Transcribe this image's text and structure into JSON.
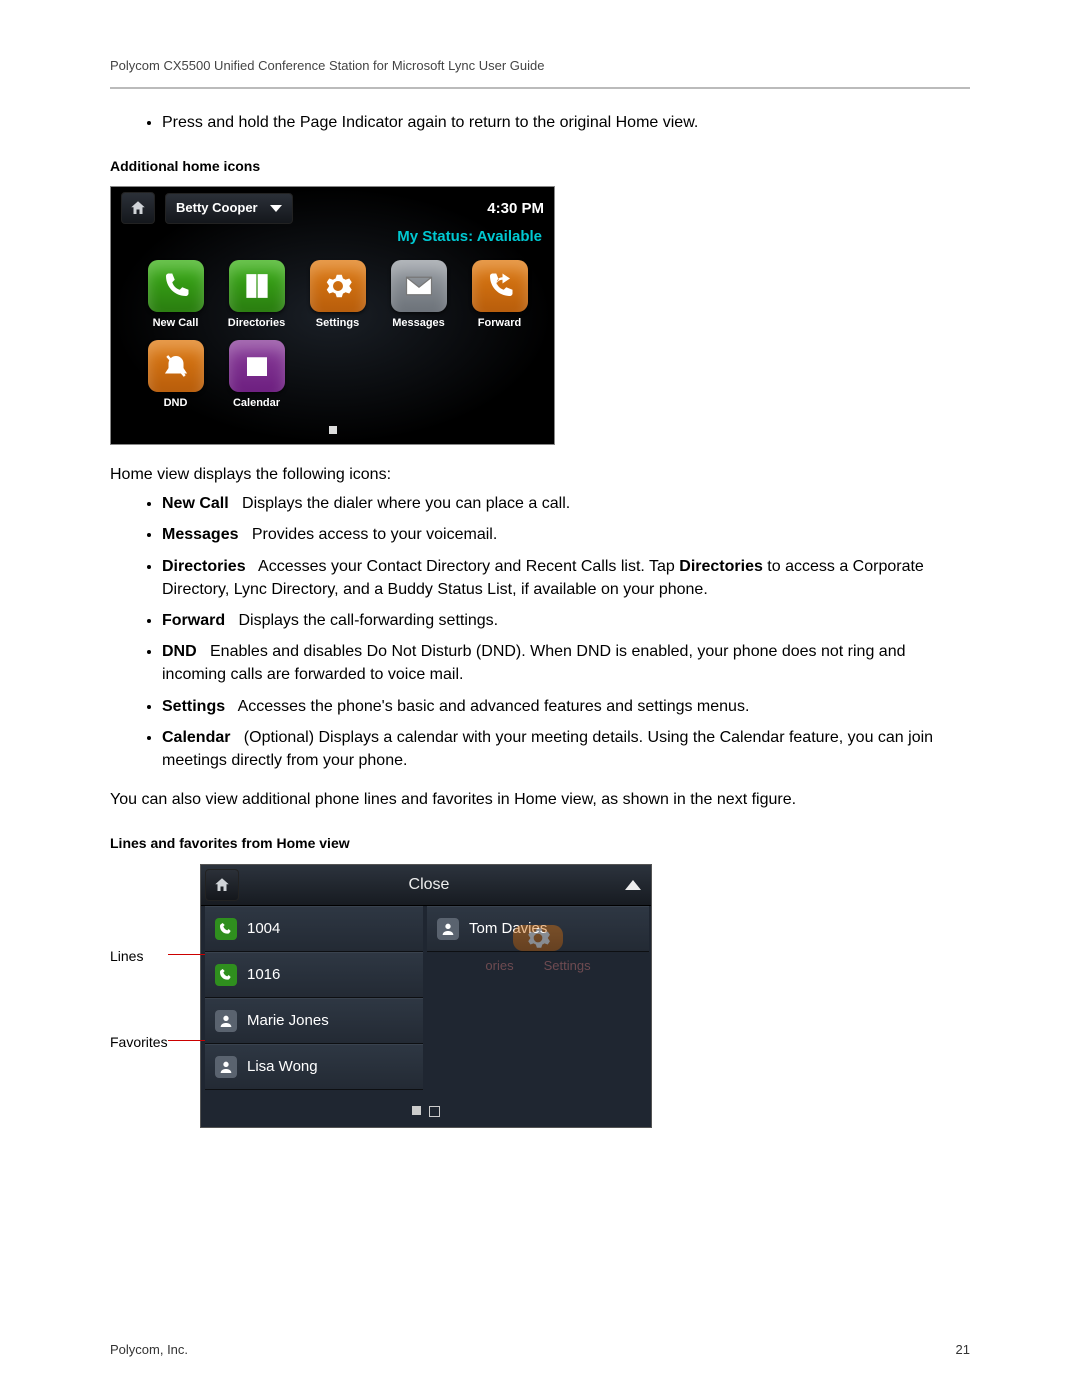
{
  "doc_header": "Polycom CX5500 Unified Conference Station for Microsoft Lync User Guide",
  "bullet_intro": "Press and hold the Page Indicator again to return to the original Home view.",
  "caption1": "Additional home icons",
  "device1": {
    "user": "Betty Cooper",
    "clock": "4:30 PM",
    "status_prefix": "My Status: ",
    "status_value": "Available",
    "icons": [
      {
        "name": "New Call",
        "color": "green",
        "svg": "phone"
      },
      {
        "name": "Directories",
        "color": "green",
        "svg": "book"
      },
      {
        "name": "Settings",
        "color": "orange",
        "svg": "gear"
      },
      {
        "name": "Messages",
        "color": "gray",
        "svg": "mail"
      },
      {
        "name": "Forward",
        "color": "orange",
        "svg": "fwd"
      },
      {
        "name": "DND",
        "color": "orange",
        "svg": "dnd"
      },
      {
        "name": "Calendar",
        "color": "purple",
        "svg": "cal"
      }
    ]
  },
  "para_after_dev1": "Home view displays the following icons:",
  "icon_list": [
    {
      "term": "New Call",
      "desc": "Displays the dialer where you can place a call."
    },
    {
      "term": "Messages",
      "desc": "Provides access to your voicemail."
    },
    {
      "term": "Directories",
      "desc_pre": "Accesses your Contact Directory and Recent Calls list. Tap ",
      "bold": "Directories",
      "desc_post": " to access a Corporate Directory, Lync Directory, and a Buddy Status List, if available on your phone."
    },
    {
      "term": "Forward",
      "desc": "Displays the call-forwarding settings."
    },
    {
      "term": "DND",
      "desc": "Enables and disables Do Not Disturb (DND). When DND is enabled, your phone does not ring and incoming calls are forwarded to voice mail."
    },
    {
      "term": "Settings",
      "desc": "Accesses the phone's basic and advanced features and settings menus."
    },
    {
      "term": "Calendar",
      "desc": "(Optional) Displays a calendar with your meeting details. Using the Calendar feature, you can join meetings directly from your phone."
    }
  ],
  "para_after_list": "You can also view additional phone lines and favorites in Home view, as shown in the next figure.",
  "caption2": "Lines and favorites from Home view",
  "side_labels": {
    "lines": "Lines",
    "favorites": "Favorites"
  },
  "device2": {
    "close": "Close",
    "left_rows": [
      {
        "type": "line",
        "text": "1004"
      },
      {
        "type": "line",
        "text": "1016"
      },
      {
        "type": "person",
        "text": "Marie Jones"
      },
      {
        "type": "person",
        "text": "Lisa Wong"
      }
    ],
    "right_row": {
      "type": "person",
      "text": "Tom Davies"
    },
    "ghost_labels": {
      "left": "ories",
      "right": "Settings"
    }
  },
  "footer_left": "Polycom, Inc.",
  "footer_right": "21"
}
